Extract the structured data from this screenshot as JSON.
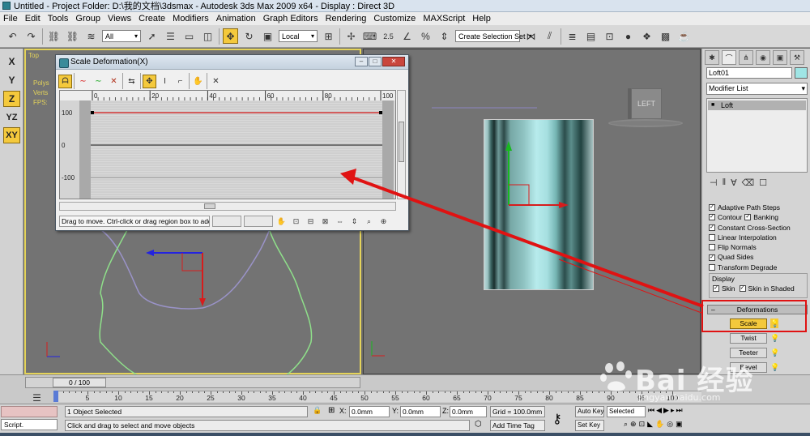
{
  "window": {
    "title": "Untitled     - Project Folder: D:\\我的文档\\3dsmax     - Autodesk 3ds Max  2009 x64     - Display : Direct 3D"
  },
  "menu": [
    "File",
    "Edit",
    "Tools",
    "Group",
    "Views",
    "Create",
    "Modifiers",
    "Animation",
    "Graph Editors",
    "Rendering",
    "Customize",
    "MAXScript",
    "Help"
  ],
  "toolbar": {
    "selection_filter": "All",
    "reference_coord": "Local",
    "named_selection_placeholder": "Create Selection Set",
    "snap_angle": "2.5",
    "snap_percent": "%"
  },
  "axis_constraints": [
    "X",
    "Y",
    "Z",
    "YZ",
    "XY"
  ],
  "viewports": {
    "left": {
      "label": "Top",
      "stats": [
        "Polys",
        "Verts",
        "",
        "FPS:"
      ]
    },
    "right": {
      "cube_label": "LEFT"
    }
  },
  "dialog": {
    "title": "Scale Deformation(X)",
    "x_ticks": [
      "0",
      "20",
      "40",
      "60",
      "80",
      "100"
    ],
    "y_ticks": [
      "100",
      "0",
      "-100"
    ],
    "status_message": "Drag to move. Ctrl-click or drag region box to add to s",
    "curve": {
      "points": [
        [
          0,
          100
        ],
        [
          100,
          100
        ]
      ]
    }
  },
  "command_panel": {
    "object_name": "Loft01",
    "modifier_list": "Modifier List",
    "stack_item": "Loft",
    "options": [
      {
        "label": "Adaptive Path Steps",
        "checked": true
      },
      {
        "label": "Contour",
        "checked": true,
        "extra_label": "Banking",
        "extra_checked": true
      },
      {
        "label": "Constant Cross-Section",
        "checked": true
      },
      {
        "label": "Linear Interpolation",
        "checked": false
      },
      {
        "label": "Flip Normals",
        "checked": false
      },
      {
        "label": "Quad Sides",
        "checked": true
      },
      {
        "label": "Transform Degrade",
        "checked": false
      }
    ],
    "display": {
      "label": "Display",
      "skin": "Skin",
      "skin_shaded": "Skin in Shaded"
    },
    "deformations": {
      "header": "Deformations",
      "buttons": [
        "Scale",
        "Twist",
        "Teeter",
        "Bevel",
        "Fit"
      ]
    }
  },
  "timeline": {
    "frame_label": "0 / 100",
    "ticks": [
      "0",
      "5",
      "10",
      "15",
      "20",
      "25",
      "30",
      "35",
      "40",
      "45",
      "50",
      "55",
      "60",
      "65",
      "70",
      "75",
      "80",
      "85",
      "90",
      "95",
      "100"
    ]
  },
  "status": {
    "script_label": "Script.",
    "selected": "1 Object Selected",
    "prompt": "Click and drag to select and move objects",
    "x_label": "X:",
    "x_value": "0.0mm",
    "y_label": "Y:",
    "y_value": "0.0mm",
    "z_label": "Z:",
    "z_value": "0.0mm",
    "grid": "Grid = 100.0mm",
    "add_time_tag": "Add Time Tag",
    "auto_key": "Auto Key",
    "set_key": "Set Key",
    "selected_dd": "Selected"
  },
  "watermark": {
    "text": "Bai  经验",
    "sub": "jingyan.baidu.com"
  },
  "colors": {
    "accent": "#f4c93c",
    "annotation_red": "#e01212",
    "viewport_bg": "#737373",
    "loft_cyan": "#9fe5e5"
  }
}
